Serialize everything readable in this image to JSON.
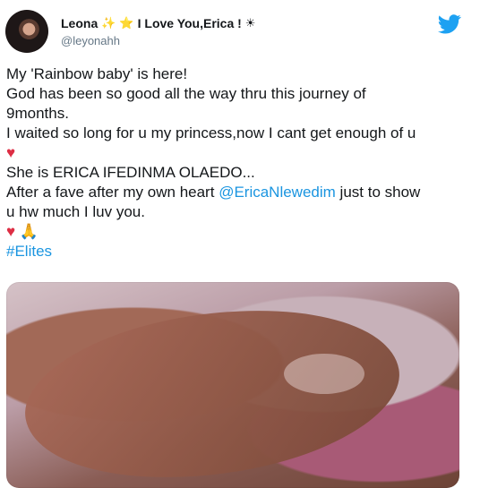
{
  "user": {
    "display_name": "Leona",
    "title": "I Love You,Erica !",
    "handle": "@leyonahh"
  },
  "tweet": {
    "lines": [
      "My 'Rainbow baby' is here!",
      "God has been so good all the way thru this journey of",
      "9months.",
      "I waited so long for u my princess,now I cant get enough of u",
      "She is ERICA IFEDINMA OLAEDO...",
      "After a fave after my own heart",
      "just to show",
      "u hw much I luv you."
    ],
    "mention": "@EricaNlewedim",
    "hashtag": "#Elites"
  },
  "icons": {
    "twitter": "twitter-bird-icon",
    "heart": "heart-icon",
    "pray": "folded-hands-icon",
    "star": "star-icon",
    "sparkle": "sparkle-icon"
  },
  "colors": {
    "link": "#1b95e0",
    "text": "#14171a",
    "muted": "#657786",
    "heart": "#dd2e44"
  }
}
